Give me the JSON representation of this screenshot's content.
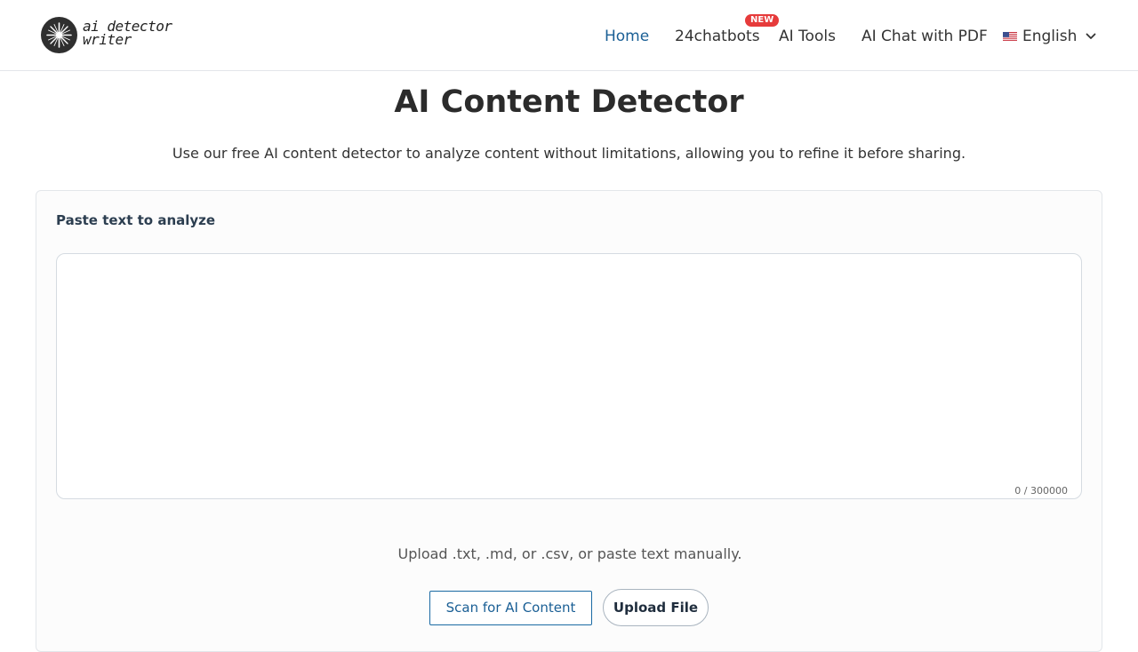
{
  "brand": {
    "logo_line1": "ai detector",
    "logo_line2": "writer",
    "logo_icon": "starburst-logo-icon"
  },
  "nav": {
    "items": [
      {
        "label": "Home",
        "active": true
      },
      {
        "label": "24chatbots",
        "badge": "NEW"
      },
      {
        "label": "AI Tools"
      },
      {
        "label": "AI Chat with PDF"
      }
    ],
    "language": {
      "label": "English",
      "flag_icon": "us-flag-icon",
      "chevron_icon": "chevron-down-icon"
    }
  },
  "hero": {
    "title": "AI Content Detector",
    "subtitle": "Use our free AI content detector to analyze content without limitations, allowing you to refine it before sharing."
  },
  "analyzer": {
    "label": "Paste text to analyze",
    "text_value": "",
    "counter": "0 / 300000",
    "upload_hint": "Upload .txt, .md, or .csv, or paste text manually.",
    "scan_button": "Scan for AI Content",
    "upload_button": "Upload File"
  },
  "colors": {
    "accent": "#1a5f95",
    "badge": "#e63b3b",
    "border": "#e3e6ea"
  }
}
